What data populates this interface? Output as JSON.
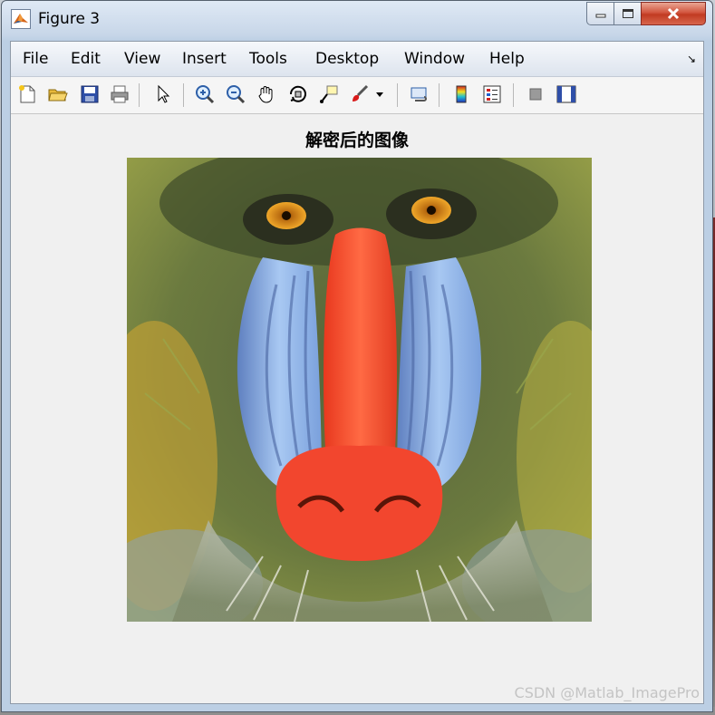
{
  "window": {
    "title": "Figure 3"
  },
  "menu": {
    "items": [
      "File",
      "Edit",
      "View",
      "Insert",
      "Tools",
      "Desktop",
      "Window",
      "Help"
    ]
  },
  "toolbar": {
    "icons": [
      "new-figure-icon",
      "open-file-icon",
      "save-icon",
      "print-icon",
      "edit-plot-arrow-icon",
      "zoom-in-icon",
      "zoom-out-icon",
      "pan-hand-icon",
      "rotate-3d-icon",
      "data-cursor-icon",
      "brush-icon",
      "brush-dropdown-icon",
      "link-plot-icon",
      "colorbar-icon",
      "legend-icon",
      "hide-plot-tools-icon",
      "show-plot-tools-icon"
    ]
  },
  "plot": {
    "title": "解密后的图像",
    "image": "baboon-mandrill-face"
  },
  "watermark": "CSDN @Matlab_ImagePro",
  "colors": {
    "nose": "#f2462e",
    "cheeks": "#8fb5ea",
    "fur": "#5d6a38",
    "eyes": "#e89a1c",
    "beard": "#c9cbbb"
  }
}
